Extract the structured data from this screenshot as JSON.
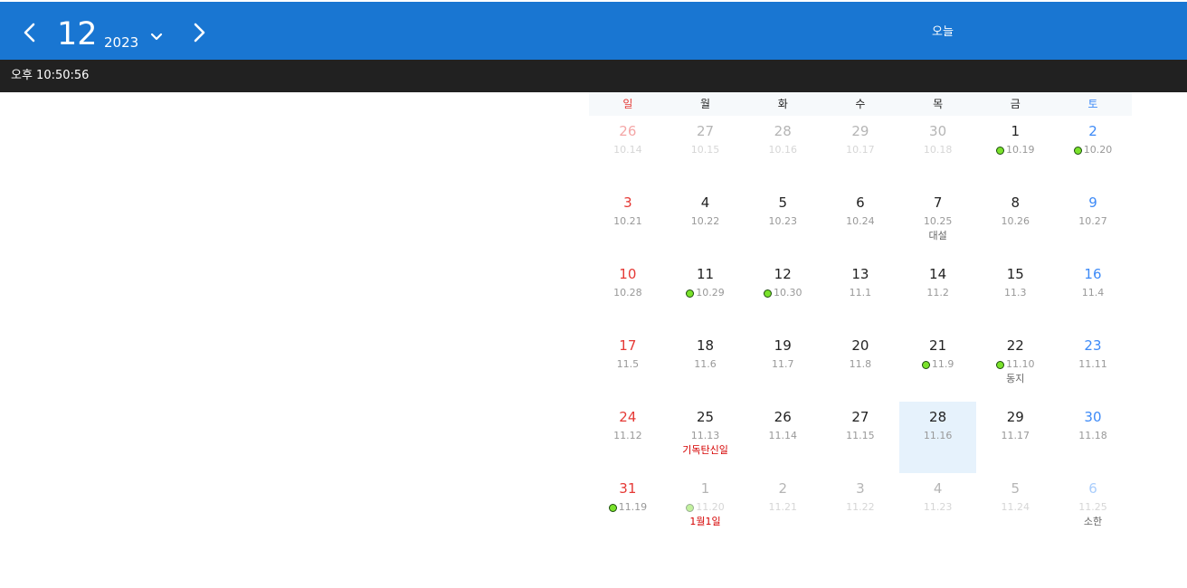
{
  "header": {
    "month": "12",
    "year": "2023",
    "today_label": "오늘"
  },
  "clock": {
    "time": "오후 10:50:56"
  },
  "weekdays": [
    "일",
    "월",
    "화",
    "수",
    "목",
    "금",
    "토"
  ],
  "colors": {
    "header_bg": "#1976d2",
    "timebar_bg": "#212121",
    "today_bg": "#e6f2fc",
    "sunday": "#e53935",
    "saturday": "#3d8af7",
    "event_dot": "#7ae22b"
  },
  "days": [
    {
      "d": "26",
      "l": "10.14",
      "out": true
    },
    {
      "d": "27",
      "l": "10.15",
      "out": true
    },
    {
      "d": "28",
      "l": "10.16",
      "out": true
    },
    {
      "d": "29",
      "l": "10.17",
      "out": true
    },
    {
      "d": "30",
      "l": "10.18",
      "out": true
    },
    {
      "d": "1",
      "l": "10.19",
      "dot": true
    },
    {
      "d": "2",
      "l": "10.20",
      "dot": true
    },
    {
      "d": "3",
      "l": "10.21"
    },
    {
      "d": "4",
      "l": "10.22"
    },
    {
      "d": "5",
      "l": "10.23"
    },
    {
      "d": "6",
      "l": "10.24"
    },
    {
      "d": "7",
      "l": "10.25",
      "note": "대설"
    },
    {
      "d": "8",
      "l": "10.26"
    },
    {
      "d": "9",
      "l": "10.27"
    },
    {
      "d": "10",
      "l": "10.28"
    },
    {
      "d": "11",
      "l": "10.29",
      "dot": true
    },
    {
      "d": "12",
      "l": "10.30",
      "dot": true
    },
    {
      "d": "13",
      "l": "11.1"
    },
    {
      "d": "14",
      "l": "11.2"
    },
    {
      "d": "15",
      "l": "11.3"
    },
    {
      "d": "16",
      "l": "11.4"
    },
    {
      "d": "17",
      "l": "11.5"
    },
    {
      "d": "18",
      "l": "11.6"
    },
    {
      "d": "19",
      "l": "11.7"
    },
    {
      "d": "20",
      "l": "11.8"
    },
    {
      "d": "21",
      "l": "11.9",
      "dot": true
    },
    {
      "d": "22",
      "l": "11.10",
      "dot": true,
      "note": "동지"
    },
    {
      "d": "23",
      "l": "11.11"
    },
    {
      "d": "24",
      "l": "11.12"
    },
    {
      "d": "25",
      "l": "11.13",
      "note": "기독탄신일",
      "holiday": true
    },
    {
      "d": "26",
      "l": "11.14"
    },
    {
      "d": "27",
      "l": "11.15"
    },
    {
      "d": "28",
      "l": "11.16",
      "today": true
    },
    {
      "d": "29",
      "l": "11.17"
    },
    {
      "d": "30",
      "l": "11.18"
    },
    {
      "d": "31",
      "l": "11.19",
      "dot": true
    },
    {
      "d": "1",
      "l": "11.20",
      "out": true,
      "dot": true,
      "note": "1월1일",
      "holiday": true
    },
    {
      "d": "2",
      "l": "11.21",
      "out": true
    },
    {
      "d": "3",
      "l": "11.22",
      "out": true
    },
    {
      "d": "4",
      "l": "11.23",
      "out": true
    },
    {
      "d": "5",
      "l": "11.24",
      "out": true
    },
    {
      "d": "6",
      "l": "11.25",
      "out": true,
      "note": "소한"
    }
  ]
}
